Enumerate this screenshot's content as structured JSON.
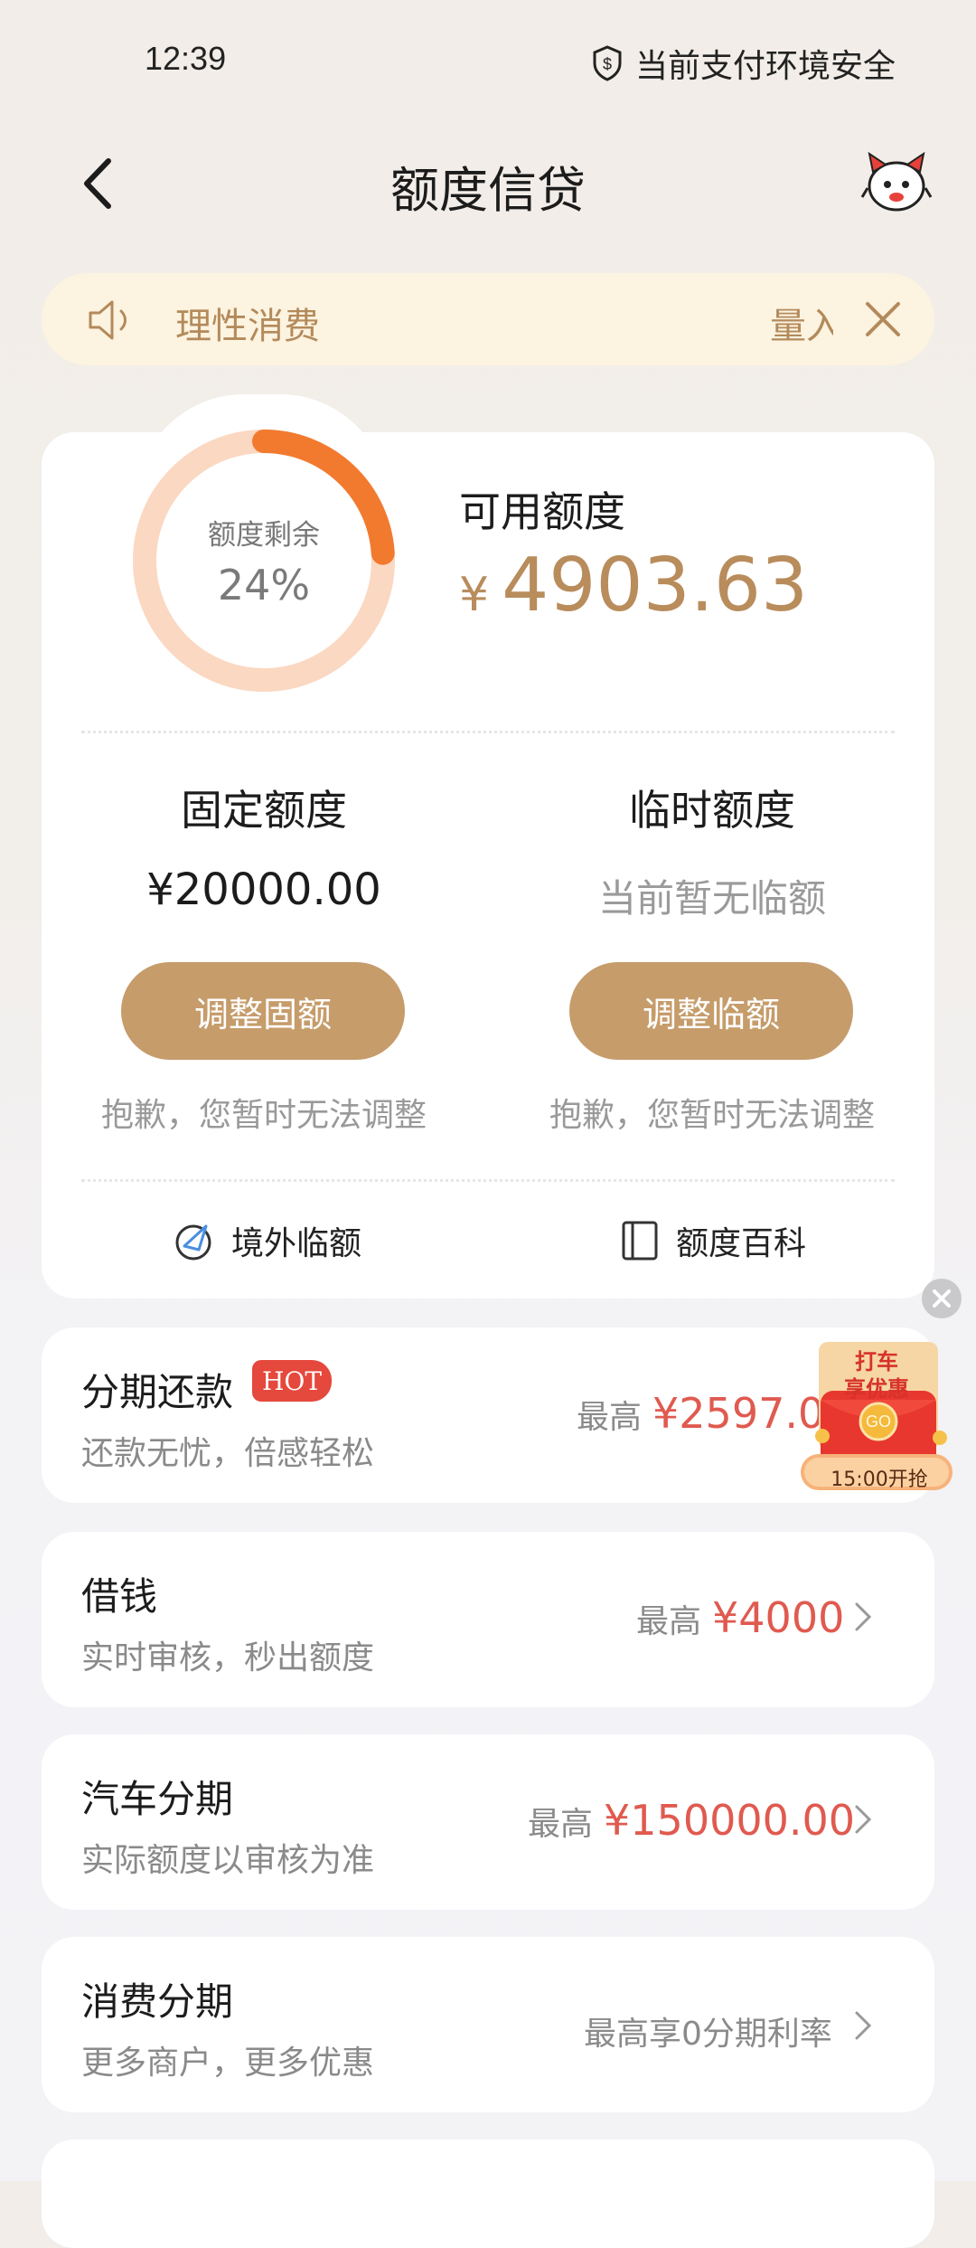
{
  "status_bar": {
    "time": "12:39",
    "security_text": "当前支付环境安全"
  },
  "header": {
    "title": "额度信贷"
  },
  "notice": {
    "text": "理性消费",
    "scroll_text": "量入"
  },
  "credit": {
    "ring_label": "额度剩余",
    "ring_percent_text": "24%",
    "ring_percent_value": 24,
    "available_label": "可用额度",
    "currency_symbol": "¥",
    "available_amount": "4903.63"
  },
  "fixed": {
    "title": "固定额度",
    "value": "¥20000.00",
    "button": "调整固额",
    "note": "抱歉，您暂时无法调整"
  },
  "temporary": {
    "title": "临时额度",
    "value": "当前暂无临额",
    "button": "调整临额",
    "note": "抱歉，您暂时无法调整"
  },
  "links": {
    "overseas": "境外临额",
    "encyclopedia": "额度百科"
  },
  "items": [
    {
      "title": "分期还款",
      "badge": "HOT",
      "subtitle": "还款无忧，倍感轻松",
      "prefix": "最高",
      "amount": "¥2597.0"
    },
    {
      "title": "借钱",
      "subtitle": "实时审核，秒出额度",
      "prefix": "最高",
      "amount": "¥4000"
    },
    {
      "title": "汽车分期",
      "subtitle": "实际额度以审核为准",
      "prefix": "最高",
      "amount": "¥150000.00"
    },
    {
      "title": "消费分期",
      "subtitle": "更多商户，更多优惠",
      "prefix": "最高享0分期利率",
      "amount": ""
    }
  ],
  "promo": {
    "line1": "打车",
    "line2": "享优惠",
    "go": "GO",
    "time_text": "15:00开抢"
  },
  "colors": {
    "accent": "#c69c6b",
    "ring_track": "#fbd8c2",
    "ring_fill": "#f27a2f",
    "price_red": "#e05a4f"
  }
}
